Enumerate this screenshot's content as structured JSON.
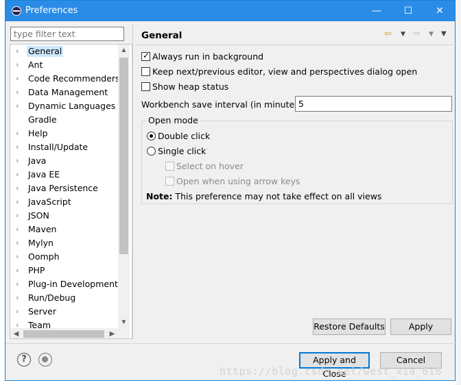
{
  "window": {
    "title": "Preferences",
    "minimize_glyph": "—",
    "maximize_glyph": "☐",
    "close_glyph": "✕"
  },
  "filter": {
    "placeholder": "type filter text",
    "value": ""
  },
  "tree": {
    "items": [
      {
        "label": "General",
        "selected": true
      },
      {
        "label": "Ant"
      },
      {
        "label": "Code Recommenders"
      },
      {
        "label": "Data Management"
      },
      {
        "label": "Dynamic Languages"
      },
      {
        "label": "Gradle",
        "no_expander": true
      },
      {
        "label": "Help"
      },
      {
        "label": "Install/Update"
      },
      {
        "label": "Java"
      },
      {
        "label": "Java EE"
      },
      {
        "label": "Java Persistence"
      },
      {
        "label": "JavaScript"
      },
      {
        "label": "JSON"
      },
      {
        "label": "Maven"
      },
      {
        "label": "Mylyn"
      },
      {
        "label": "Oomph"
      },
      {
        "label": "PHP"
      },
      {
        "label": "Plug-in Development"
      },
      {
        "label": "Run/Debug"
      },
      {
        "label": "Server"
      },
      {
        "label": "Team"
      }
    ]
  },
  "page": {
    "title": "General",
    "options": {
      "always_run_background": {
        "label": "Always run in background",
        "checked": true
      },
      "keep_next_prev": {
        "label": "Keep next/previous editor, view and perspectives dialog open",
        "checked": false
      },
      "show_heap": {
        "label": "Show heap status",
        "checked": false
      }
    },
    "interval": {
      "label": "Workbench save interval (in minutes):",
      "value": "5"
    },
    "open_mode": {
      "title": "Open mode",
      "double_click": "Double click",
      "single_click": "Single click",
      "select_on_hover": "Select on hover",
      "open_arrow_keys": "Open when using arrow keys",
      "selected": "double_click"
    },
    "note": {
      "bold": "Note:",
      "text": " This preference may not take effect on all views"
    }
  },
  "buttons": {
    "restore_defaults": "Restore Defaults",
    "apply": "Apply",
    "apply_and_close": "Apply and Close",
    "cancel": "Cancel"
  },
  "icons": {
    "back": "⇦",
    "forward": "⇨",
    "dropdown": "▼",
    "help": "?"
  },
  "watermark": "https://blog.csdn.net/west_xia_6i6",
  "colors": {
    "titlebar": "#2b8ce7",
    "selection": "#cce8ff",
    "default_button_border": "#0078d7"
  }
}
